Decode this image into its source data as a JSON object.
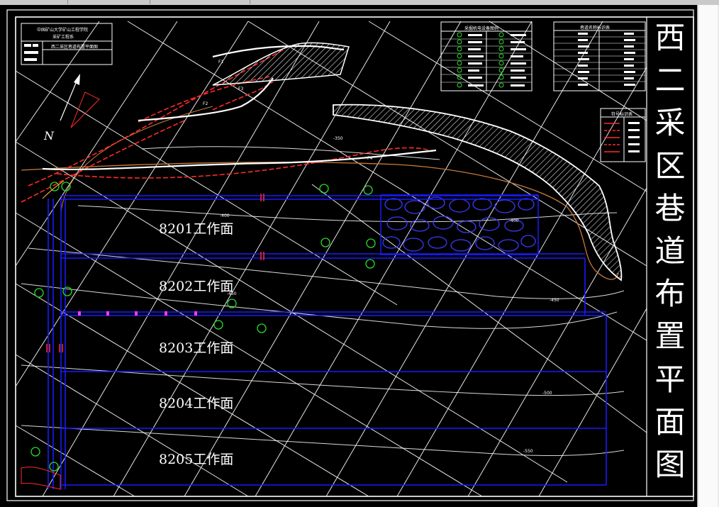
{
  "title_chars": [
    "西",
    "二",
    "采",
    "区",
    "巷",
    "道",
    "布",
    "置",
    "平",
    "面",
    "图"
  ],
  "faces": [
    "8201工作面",
    "8202工作面",
    "8203工作面",
    "8204工作面",
    "8205工作面"
  ],
  "north": "N",
  "title_block": {
    "line1": "中国矿山大学矿山工程学院",
    "line2": "采矿工程系",
    "line3": "西二采区巷道布置平面图"
  },
  "legend_equipment": "采掘机电设备图例",
  "legend_roadway": "巷道名称标识表",
  "legend_symbols": "符号标识表",
  "contours": [
    "-400",
    "-400",
    "-450",
    "-450",
    "-500",
    "-550",
    "-350"
  ],
  "faults": [
    "F1",
    "F2",
    "F3",
    "F4"
  ],
  "colors": {
    "bg": "#000000",
    "grid": "#ffffff",
    "roadway": "#1a1aff",
    "fault": "#ff2a2a",
    "contour": "#c87a3a",
    "equip": "#2adc2a"
  }
}
